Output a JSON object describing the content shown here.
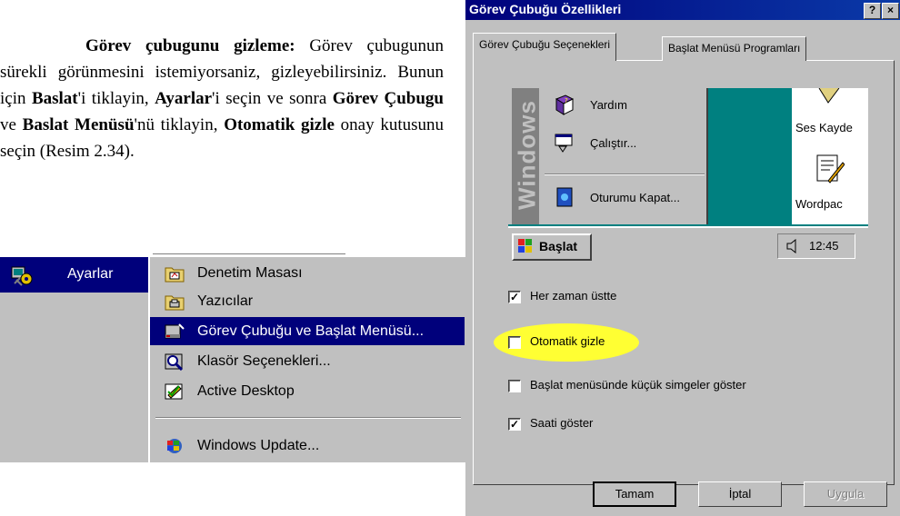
{
  "document": {
    "heading": "Görev çubugunu gizleme:",
    "t1": " Görev çubugunun sürekli görünmesini istemiyorsaniz, gizleyebilirsiniz. Bunun için ",
    "b_baslat": "Baslat",
    "t2": "'i tiklayin, ",
    "b_ayarlar": "Ayarlar",
    "t3": "'i seçin ve sonra ",
    "b_gorev": "Görev Çubugu",
    "t4": " ve ",
    "b_menu": "Baslat Menüsü",
    "t5": "'nü tiklayin, ",
    "b_oto": "Otomatik gizle",
    "t6": " onay kutusunu seçin (Resim 2.34)."
  },
  "start_menu": {
    "selected_item": "Ayarlar",
    "submenu": [
      {
        "label": "Denetim Masası",
        "icon": "control-panel-icon"
      },
      {
        "label": "Yazıcılar",
        "icon": "printers-icon"
      },
      {
        "label": "Görev Çubuğu ve Başlat Menüsü...",
        "icon": "taskbar-icon",
        "selected": true
      },
      {
        "label": "Klasör Seçenekleri...",
        "icon": "folder-options-icon"
      },
      {
        "label": "Active Desktop",
        "icon": "active-desktop-icon"
      },
      {
        "label": "Windows Update...",
        "icon": "windows-update-icon"
      }
    ]
  },
  "dialog": {
    "title": "Görev Çubuğu Özellikleri",
    "help_btn": "?",
    "close_btn": "×",
    "tabs": [
      "Görev Çubuğu Seçenekleri",
      "Başlat Menüsü Programları"
    ],
    "preview": {
      "strip_text": "Windows",
      "menu_items": [
        "Yardım",
        "Çalıştır...",
        "Oturumu Kapat..."
      ],
      "desktop_items": [
        "Ses Kayde",
        "Wordpac"
      ],
      "start_label": "Başlat",
      "clock": "12:45"
    },
    "options": [
      {
        "label": "Her zaman üstte",
        "checked": true
      },
      {
        "label": "Otomatik gizle",
        "checked": false,
        "highlighted": true
      },
      {
        "label": "Başlat menüsünde küçük simgeler göster",
        "checked": false
      },
      {
        "label": "Saati göster",
        "checked": true
      }
    ],
    "buttons": [
      "Tamam",
      "İptal",
      "Uygula"
    ],
    "colors": {
      "title_bar": "#00007b",
      "highlight": "#ffff33",
      "desktop": "#008080"
    }
  }
}
